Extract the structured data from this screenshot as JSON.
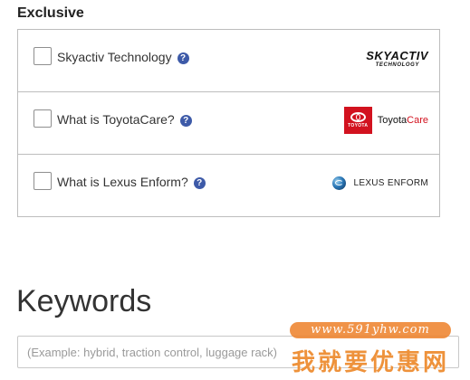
{
  "section": {
    "title": "Exclusive"
  },
  "options": [
    {
      "label": "Skyactiv Technology",
      "help": "?",
      "logo": {
        "main": "SKYACTIV",
        "sub": "TECHNOLOGY"
      }
    },
    {
      "label": "What is ToyotaCare?",
      "help": "?",
      "logo": {
        "badge": "TOYOTA",
        "part1": "Toyota",
        "part2": "Care"
      }
    },
    {
      "label": "What is Lexus Enform?",
      "help": "?",
      "logo": {
        "text": "LEXUS ENFORM"
      }
    }
  ],
  "keywords": {
    "title": "Keywords",
    "placeholder": "(Example: hybrid, traction control, luggage rack)"
  },
  "watermark": {
    "url": "www.591yhw.com",
    "text": "我就要优惠网"
  },
  "colors": {
    "help_icon": "#3d5aa8",
    "toyota_red": "#d2121f",
    "watermark_orange": "#ec8626"
  }
}
